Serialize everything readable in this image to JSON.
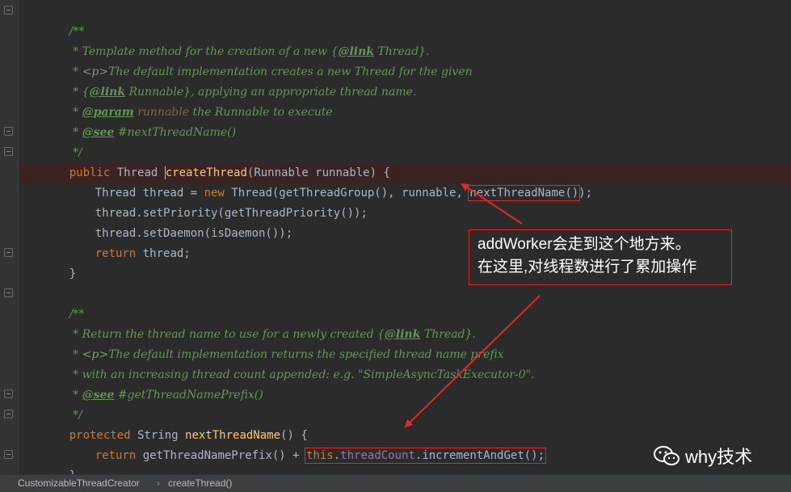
{
  "code": {
    "l1": "/**",
    "l2_a": " * Template method for the creation of a new ",
    "l2_link": "@link",
    "l2_b": " Thread}.",
    "l3_a": " * ",
    "l3_p": "<p>",
    "l3_b": "The default implementation creates a new Thread for the given",
    "l4_a": " * {",
    "l4_link": "@link",
    "l4_b": " Runnable}, applying an appropriate thread name.",
    "l5_a": " * ",
    "l5_tag": "@param",
    "l5_param": " runnable",
    "l5_b": " the Runnable to execute",
    "l6_a": " * ",
    "l6_tag": "@see",
    "l6_b": " #nextThreadName()",
    "l7": " */",
    "l8_public": "public",
    "l8_type": " Thread ",
    "l8_name": "createThread",
    "l8_rest": "(Runnable runnable) {",
    "l9_a": "Thread thread = ",
    "l9_new": "new",
    "l9_b": " Thread(getThreadGroup(), runnable, ",
    "l9_boxed": "nextThreadName()",
    "l9_c": ");",
    "l10": "thread.setPriority(getThreadPriority());",
    "l11": "thread.setDaemon(isDaemon());",
    "l12_ret": "return",
    "l12_b": " thread;",
    "l13": "}",
    "l15": "/**",
    "l16_a": " * Return the thread name to use for a newly created {",
    "l16_link": "@link",
    "l16_b": " Thread}.",
    "l17_a": " * ",
    "l17_p": "<p>",
    "l17_b": "The default implementation returns the specified thread name prefix",
    "l18": " * with an increasing thread count appended: e.g. \"SimpleAsyncTaskExecutor-0\".",
    "l19_a": " * ",
    "l19_tag": "@see",
    "l19_b": " #getThreadNamePrefix()",
    "l20": " */",
    "l21_prot": "protected",
    "l21_type": " String ",
    "l21_name": "nextThreadName",
    "l21_rest": "() {",
    "l22_ret": "return",
    "l22_b": " getThreadNamePrefix() + ",
    "l22_this": "this",
    "l22_dot": ".",
    "l22_field": "threadCount",
    "l22_c": ".incrementAndGet();",
    "l23": "}"
  },
  "callout": {
    "line1": "addWorker会走到这个地方来。",
    "line2": "在这里,对线程数进行了累加操作"
  },
  "breadcrumb": {
    "class_name": "CustomizableThreadCreator",
    "separator": "›",
    "method_name": "createThread()"
  },
  "watermark": {
    "text": "why技术",
    "icon": "wechat-icon"
  },
  "colors": {
    "annotation_red": "#e02a2a",
    "editor_bg": "#2b2b2b",
    "doc_comment": "#629755",
    "keyword": "#cc7832"
  }
}
